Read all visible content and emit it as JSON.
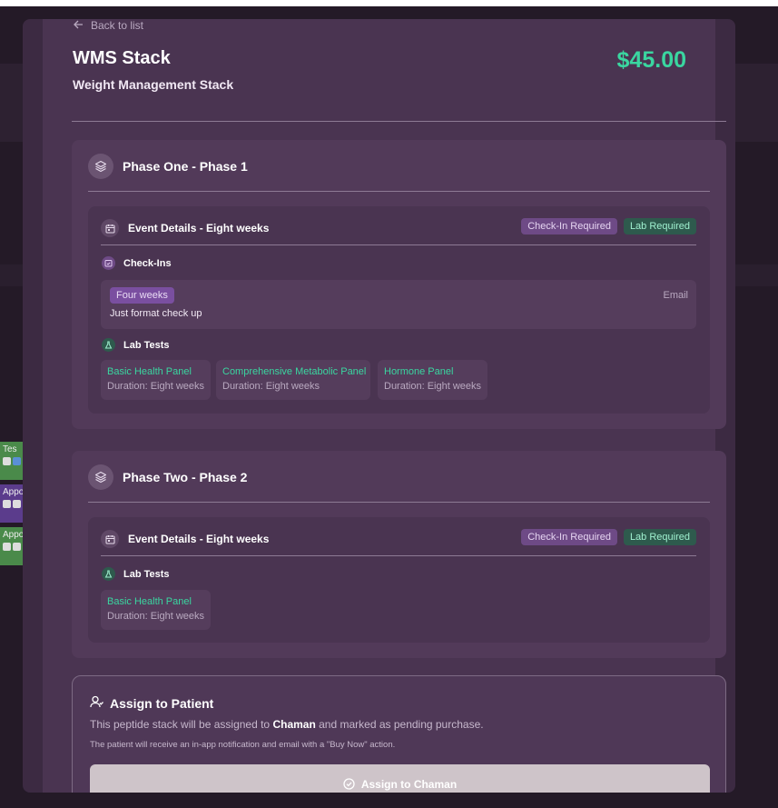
{
  "background_events": [
    {
      "label": "Tes"
    },
    {
      "label": "Appo"
    },
    {
      "label": "Appo"
    }
  ],
  "nav": {
    "back_label": "Back to list"
  },
  "stack": {
    "title": "WMS Stack",
    "subtitle": "Weight Management Stack",
    "price": "$45.00"
  },
  "phases": [
    {
      "title": "Phase One - Phase 1",
      "event": {
        "title": "Event Details - Eight weeks",
        "badges": [
          "Check-In Required",
          "Lab Required"
        ],
        "checkins_label": "Check-Ins",
        "checkin": {
          "period": "Four weeks",
          "channel": "Email",
          "note": "Just format check up"
        },
        "labs_label": "Lab Tests",
        "labs": [
          {
            "name": "Basic Health Panel",
            "duration": "Duration: Eight weeks"
          },
          {
            "name": "Comprehensive Metabolic Panel",
            "duration": "Duration: Eight weeks"
          },
          {
            "name": "Hormone Panel",
            "duration": "Duration: Eight weeks"
          }
        ]
      }
    },
    {
      "title": "Phase Two - Phase 2",
      "event": {
        "title": "Event Details - Eight weeks",
        "badges": [
          "Check-In Required",
          "Lab Required"
        ],
        "labs_label": "Lab Tests",
        "labs": [
          {
            "name": "Basic Health Panel",
            "duration": "Duration: Eight weeks"
          }
        ]
      }
    }
  ],
  "assign": {
    "title": "Assign to Patient",
    "desc_before": "This peptide stack will be assigned to ",
    "patient": "Chaman",
    "desc_after": " and marked as pending purchase.",
    "note": "The patient will receive an in-app notification and email with a \"Buy Now\" action.",
    "button_label": "Assign to Chaman"
  },
  "colors": {
    "accent_green": "#3ad6a0",
    "badge_purple": "#6e4a86",
    "badge_green": "#2e5a4d",
    "panel": "#4a3451"
  }
}
